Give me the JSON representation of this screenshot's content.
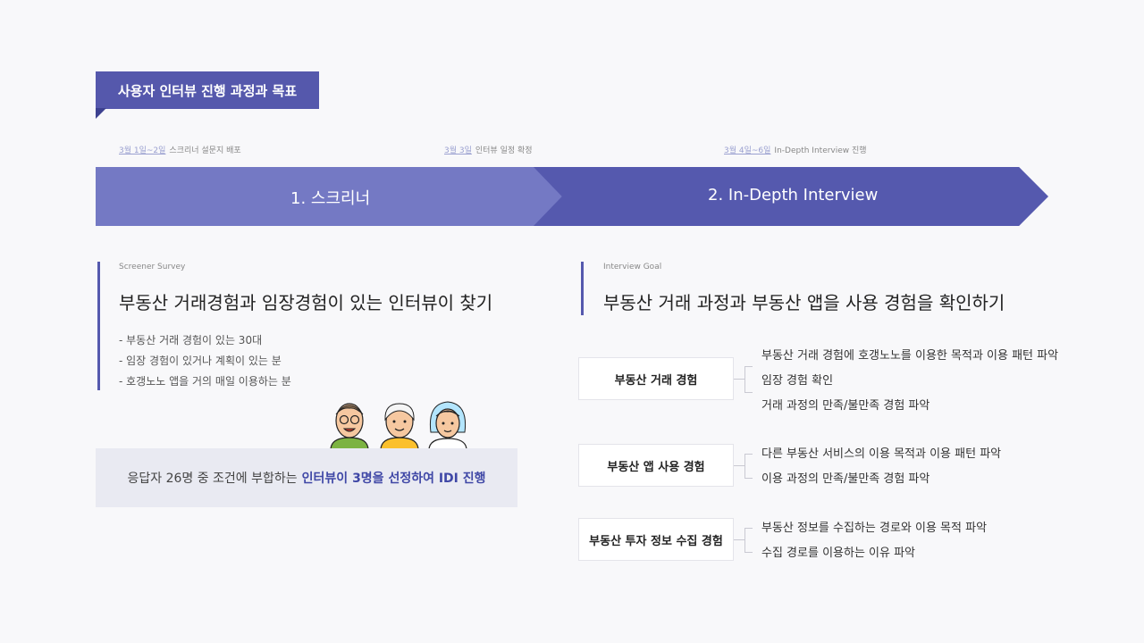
{
  "header": {
    "title": "사용자 인터뷰 진행 과정과 목표"
  },
  "schedule": [
    {
      "date": "3월 1일~2일",
      "text": "스크리너 설문지 배포"
    },
    {
      "date": "3월 3일",
      "text": "인터뷰 일정 확정"
    },
    {
      "date": "3월 4일~6일",
      "text": "In-Depth Interview 진행"
    }
  ],
  "steps": [
    {
      "label": "1. 스크리너"
    },
    {
      "label": "2. In-Depth Interview"
    }
  ],
  "screener": {
    "subtitle": "Screener Survey",
    "title": "부동산 거래경험과 임장경험이 있는 인터뷰이 찾기",
    "bullets": [
      "- 부동산 거래 경험이 있는 30대",
      "- 임장 경험이 있거나 계획이 있는 분",
      "- 호갱노노 앱을 거의 매일 이용하는 분"
    ],
    "result_prefix": "응답자 26명 중 조건에 부합하는",
    "result_highlight": "인터뷰이 3명을 선정하여 IDI 진행"
  },
  "goal": {
    "subtitle": "Interview Goal",
    "title": "부동산 거래 과정과 부동산 앱을 사용 경험을 확인하기",
    "groups": [
      {
        "label": "부동산 거래 경험",
        "items": [
          "부동산 거래 경험에 호갱노노를 이용한 목적과 이용 패턴 파악",
          "임장 경험 확인",
          "거래 과정의 만족/불만족 경험 파악"
        ]
      },
      {
        "label": "부동산 앱 사용 경험",
        "items": [
          "다른 부동산 서비스의 이용 목적과 이용 패턴 파악",
          "이용 과정의 만족/불만족 경험 파악"
        ]
      },
      {
        "label": "부동산 투자 정보 수집 경험",
        "items": [
          "부동산 정보를 수집하는 경로와 이용 목적 파악",
          "수집 경로를 이용하는 이유 파악"
        ]
      }
    ]
  },
  "colors": {
    "primary": "#5559ae",
    "light": "#7479c4",
    "highlight": "#3f47a6"
  }
}
